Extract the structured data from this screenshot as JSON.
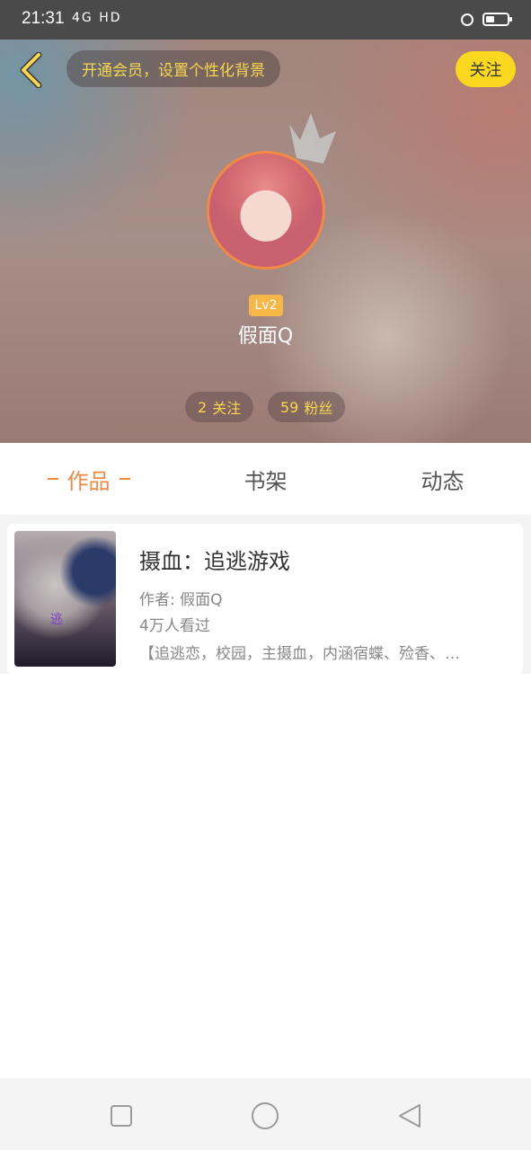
{
  "status_bar": {
    "time": "21:31",
    "network_text": "4G HD",
    "icons": [
      "signal-icon",
      "wifi-icon",
      "alarm-icon",
      "battery-icon"
    ]
  },
  "header": {
    "vip_prompt": "开通会员，设置个性化背景",
    "follow_label": "关注",
    "level": "Lv2",
    "username": "假面Q",
    "following": {
      "count": "2",
      "label": "关注"
    },
    "followers": {
      "count": "59",
      "label": "粉丝"
    }
  },
  "tabs": [
    {
      "label": "作品",
      "active": true
    },
    {
      "label": "书架",
      "active": false
    },
    {
      "label": "动态",
      "active": false
    }
  ],
  "works": [
    {
      "title": "摄血：追逃游戏",
      "author": "作者: 假面Q",
      "views": "4万人看过",
      "description": "【追逃恋，校园，主摄血，内涵宿蝶、殓香、…",
      "cover_text": "逃"
    }
  ],
  "colors": {
    "accent": "#f08a45",
    "gold": "#f8d64e",
    "follow_button": "#fbd820"
  }
}
